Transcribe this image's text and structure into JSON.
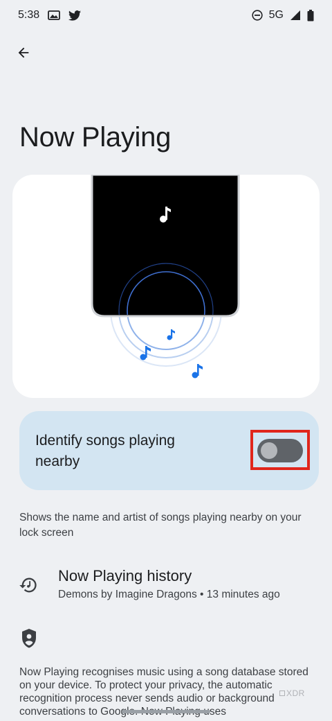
{
  "status_bar": {
    "time": "5:38",
    "network": "5G",
    "icons": [
      "gallery-icon",
      "twitter-icon",
      "do-not-disturb-icon",
      "signal-icon",
      "battery-icon"
    ]
  },
  "header": {
    "back_icon": "arrow-back-icon",
    "title": "Now Playing"
  },
  "hero": {
    "illustration": "phone-with-music-notes",
    "icons": [
      "music-note-icon"
    ]
  },
  "toggle": {
    "label": "Identify songs playing nearby",
    "state": "off",
    "highlighted": true
  },
  "description": "Shows the name and artist of songs playing nearby on your lock screen",
  "history": {
    "icon": "history-icon",
    "title": "Now Playing history",
    "subtitle": "Demons by Imagine Dragons • 13 minutes ago"
  },
  "privacy": {
    "icon": "shield-person-icon",
    "text": "Now Playing recognises music using a song database stored on your device. To protect your privacy, the automatic recognition process never sends audio or background conversations to Google. Now Playing uses"
  },
  "watermark": "XDR",
  "colors": {
    "background": "#eef0f3",
    "card": "#ffffff",
    "toggle_card": "#d3e5f2",
    "accent_blue": "#1a73e8",
    "highlight_red": "#e0261c"
  }
}
